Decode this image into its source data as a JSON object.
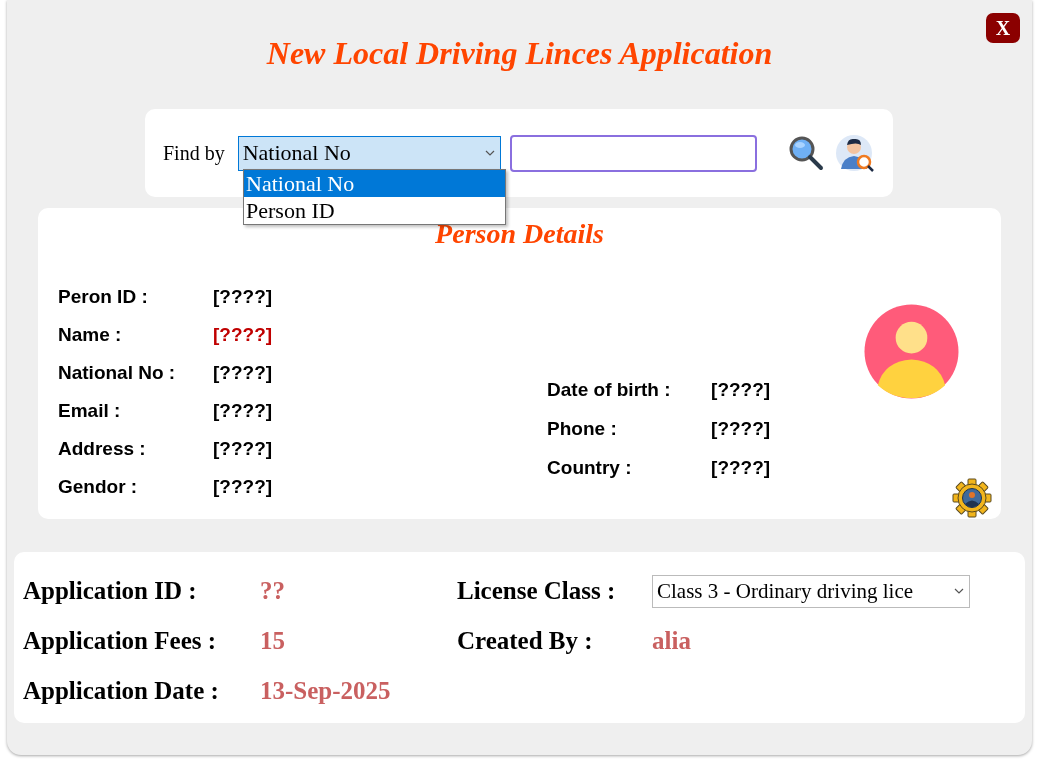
{
  "title": "New Local Driving Linces Application",
  "close_button": {
    "label": "X"
  },
  "find": {
    "label": "Find by",
    "filter": {
      "value": "National No",
      "expanded": true,
      "options": [
        {
          "label": "National No",
          "selected": true
        },
        {
          "label": "Person ID",
          "selected": false
        }
      ]
    }
  },
  "person_details": {
    "title": "Person Details",
    "fields": [
      {
        "label": "Peron ID :",
        "value": "[????]",
        "emphasis": false
      },
      {
        "label": "Name :",
        "value": "[????]",
        "emphasis": true
      },
      {
        "label": "National No :",
        "value": "[????]",
        "emphasis": false
      },
      {
        "label": "Email :",
        "value": "[????]",
        "emphasis": false
      },
      {
        "label": "Address :",
        "value": "[????]",
        "emphasis": false
      },
      {
        "label": "Gendor :",
        "value": "[????]",
        "emphasis": false
      }
    ],
    "extra_fields": [
      {
        "label": "Date of birth :",
        "value": "[????]",
        "emphasis": false
      },
      {
        "label": "Phone :",
        "value": "[????]",
        "emphasis": false
      },
      {
        "label": "Country :",
        "value": "[????]",
        "emphasis": false
      }
    ]
  },
  "application": {
    "fields": [
      {
        "label": "Application ID :",
        "value": "??"
      },
      {
        "label": "Application Fees :",
        "value": "15"
      },
      {
        "label": "Application Date :",
        "value": "13-Sep-2025"
      }
    ],
    "license_class": {
      "label": "License Class :",
      "value": "Class 3 - Ordinary driving lice"
    },
    "created_by": {
      "label": "Created By :",
      "value": "alia"
    }
  }
}
